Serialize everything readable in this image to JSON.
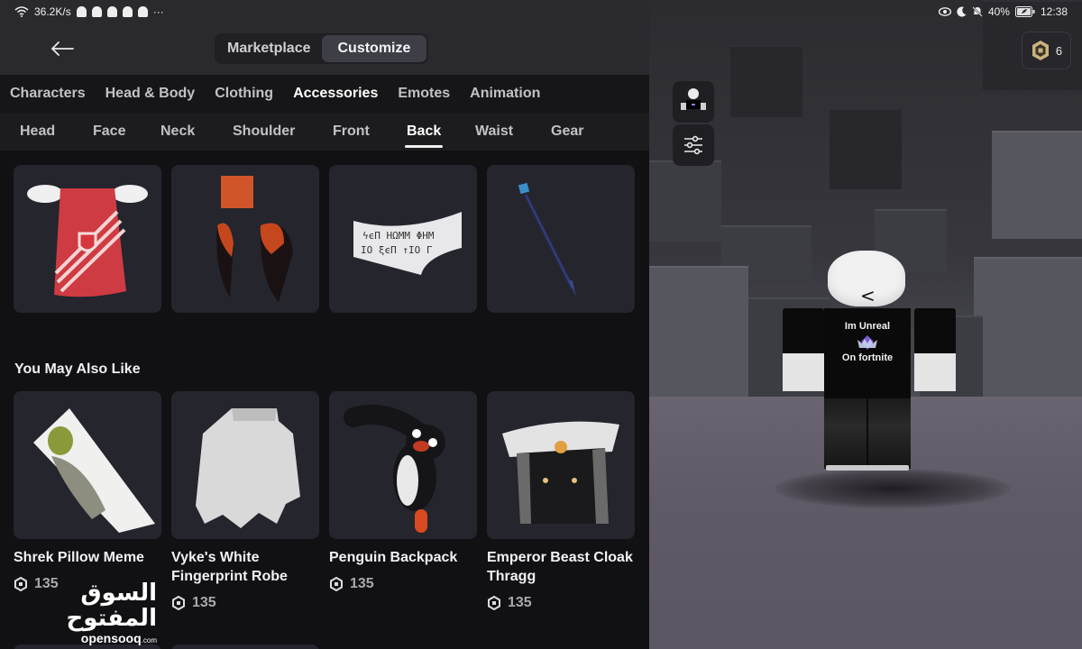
{
  "status_bar": {
    "network_speed": "36.2K/s",
    "notification_icons": [
      "snapchat-icon",
      "snapchat-icon",
      "snapchat-icon",
      "snapchat-icon",
      "snapchat-icon"
    ],
    "overflow": "···",
    "battery": "40%",
    "time": "12:38"
  },
  "header": {
    "segments": [
      {
        "label": "Marketplace",
        "active": false
      },
      {
        "label": "Customize",
        "active": true
      }
    ]
  },
  "robux": {
    "count": "6"
  },
  "category_tabs": [
    {
      "label": "Characters",
      "active": false
    },
    {
      "label": "Head & Body",
      "active": false
    },
    {
      "label": "Clothing",
      "active": false
    },
    {
      "label": "Accessories",
      "active": true
    },
    {
      "label": "Emotes",
      "active": false
    },
    {
      "label": "Animation",
      "active": false
    }
  ],
  "sub_tabs": [
    {
      "label": "Head",
      "active": false
    },
    {
      "label": "Face",
      "active": false
    },
    {
      "label": "Neck",
      "active": false
    },
    {
      "label": "Shoulder",
      "active": false
    },
    {
      "label": "Front",
      "active": false
    },
    {
      "label": "Back",
      "active": true
    },
    {
      "label": "Waist",
      "active": false
    },
    {
      "label": "Gear",
      "active": false
    }
  ],
  "owned_items": [
    {
      "thumbnail": "red-winged-cape"
    },
    {
      "thumbnail": "lava-claws"
    },
    {
      "thumbnail": "rune-scroll-banner"
    },
    {
      "thumbnail": "blue-spear"
    }
  ],
  "recommendations": {
    "title": "You May Also Like",
    "items": [
      {
        "name": "Shrek Pillow Meme",
        "price": "135",
        "thumbnail": "shrek-pillow"
      },
      {
        "name": "Vyke's White Fingerprint Robe",
        "price": "135",
        "thumbnail": "white-robe"
      },
      {
        "name": "Penguin Backpack",
        "price": "135",
        "thumbnail": "penguin"
      },
      {
        "name": "Emperor Beast Cloak Thragg",
        "price": "135",
        "thumbnail": "wolf-cloak"
      }
    ]
  },
  "avatar": {
    "shirt_line1": "Im Unreal",
    "shirt_line2": "On fortnite",
    "face": "<"
  },
  "watermark": {
    "arabic": "السوق المفتوح",
    "latin": "opensooq",
    "suffix": ".com"
  },
  "colors": {
    "panel_bg": "#111114",
    "tile_bg": "#24252d",
    "robux_gold": "#c9b37e"
  }
}
